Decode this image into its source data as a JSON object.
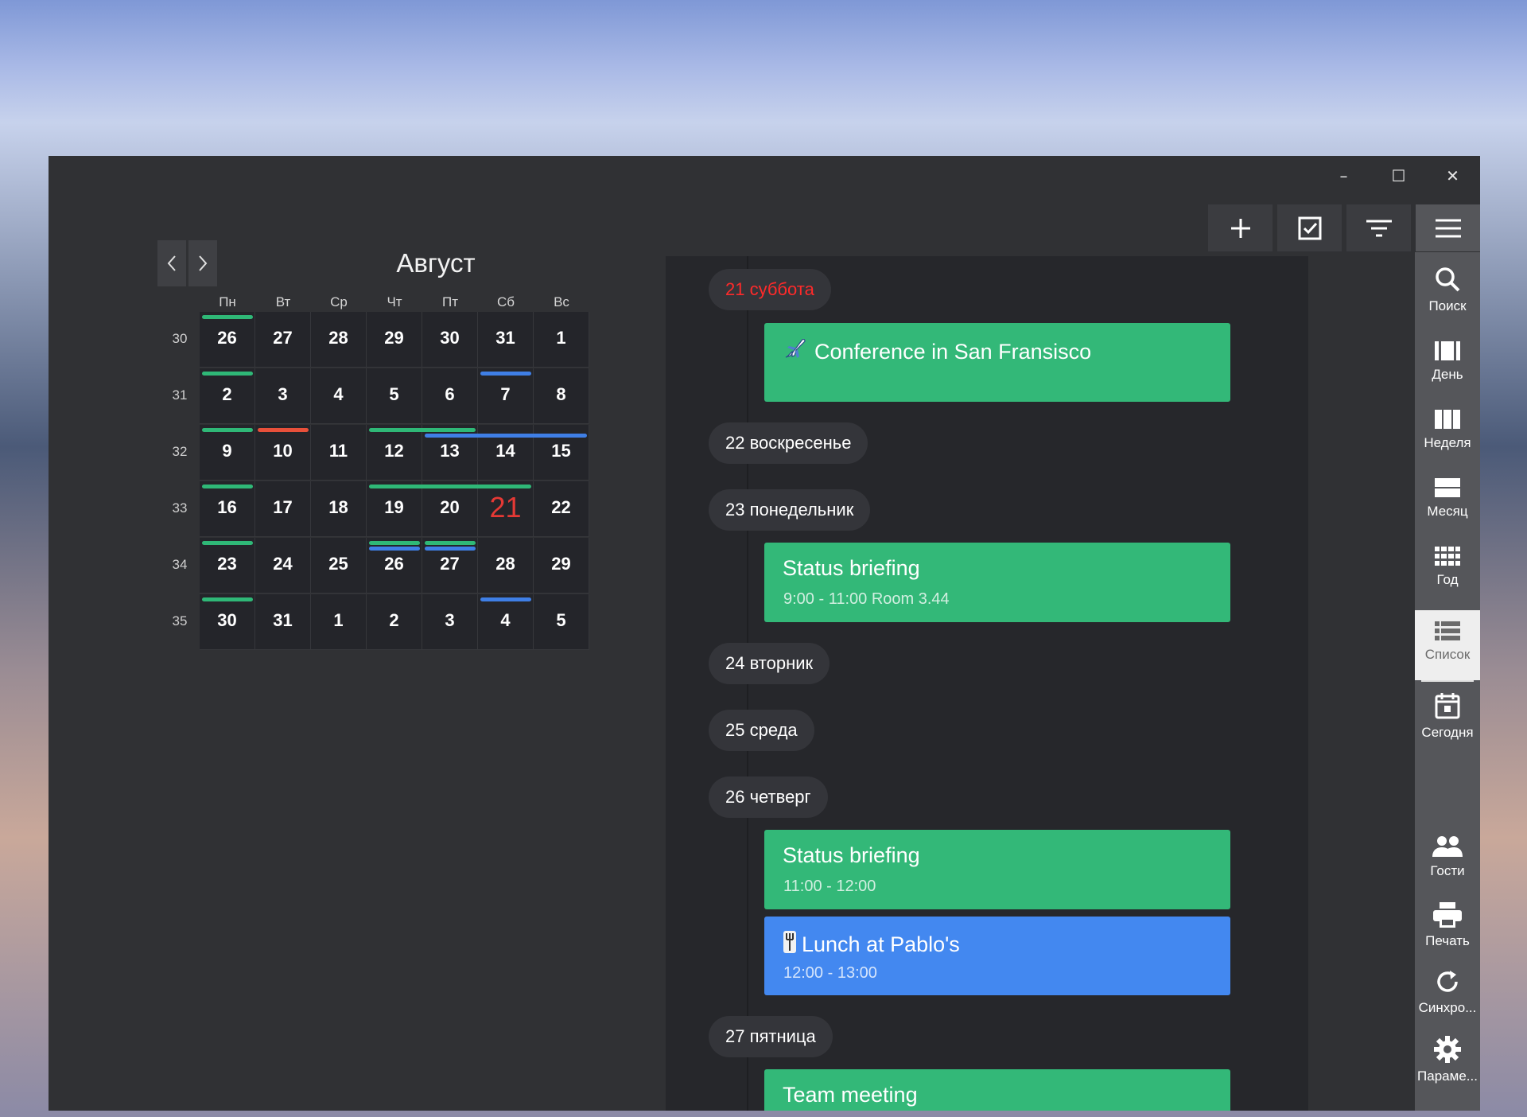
{
  "window": {
    "controls": {
      "minimize": "–",
      "maximize": "☐",
      "close": "✕"
    }
  },
  "toolbar": {
    "buttons": [
      {
        "name": "add-button",
        "icon": "plus-icon"
      },
      {
        "name": "tasks-button",
        "icon": "checkbox-icon"
      },
      {
        "name": "filter-button",
        "icon": "filter-icon"
      },
      {
        "name": "menu-button",
        "icon": "hamburger-icon"
      }
    ]
  },
  "rail": {
    "items": [
      {
        "id": "search",
        "icon": "search-icon",
        "label": "Поиск"
      },
      {
        "id": "day",
        "icon": "day-view-icon",
        "label": "День"
      },
      {
        "id": "week",
        "icon": "week-view-icon",
        "label": "Неделя"
      },
      {
        "id": "month",
        "icon": "month-view-icon",
        "label": "Месяц"
      },
      {
        "id": "year",
        "icon": "year-view-icon",
        "label": "Год"
      },
      {
        "id": "list",
        "icon": "list-view-icon",
        "label": "Список",
        "active": true
      },
      {
        "id": "today",
        "icon": "today-icon",
        "label": "Сегодня"
      },
      {
        "id": "guests",
        "icon": "people-icon",
        "label": "Гости"
      },
      {
        "id": "print",
        "icon": "printer-icon",
        "label": "Печать"
      },
      {
        "id": "sync",
        "icon": "sync-icon",
        "label": "Синхро..."
      },
      {
        "id": "settings",
        "icon": "gear-icon",
        "label": "Параме..."
      }
    ]
  },
  "calendar": {
    "month": "Август",
    "weekdays": [
      "Пн",
      "Вт",
      "Ср",
      "Чт",
      "Пт",
      "Сб",
      "Вс"
    ],
    "weeks": [
      {
        "number": "30",
        "days": [
          "26",
          "27",
          "28",
          "29",
          "30",
          "31",
          "1"
        ]
      },
      {
        "number": "31",
        "days": [
          "2",
          "3",
          "4",
          "5",
          "6",
          "7",
          "8"
        ]
      },
      {
        "number": "32",
        "days": [
          "9",
          "10",
          "11",
          "12",
          "13",
          "14",
          "15"
        ]
      },
      {
        "number": "33",
        "days": [
          "16",
          "17",
          "18",
          "19",
          "20",
          "21",
          "22"
        ]
      },
      {
        "number": "34",
        "days": [
          "23",
          "24",
          "25",
          "26",
          "27",
          "28",
          "29"
        ]
      },
      {
        "number": "35",
        "days": [
          "30",
          "31",
          "1",
          "2",
          "3",
          "4",
          "5"
        ]
      }
    ],
    "today": "21",
    "colors": {
      "green": "#2fb877",
      "blue": "#3f7fe6",
      "red": "#e8503a",
      "today": "#e53935"
    }
  },
  "agenda": {
    "days": [
      {
        "label": "21 суббота",
        "highlight": true
      },
      {
        "label": "22 воскресенье"
      },
      {
        "label": "23 понедельник"
      },
      {
        "label": "24 вторник"
      },
      {
        "label": "25 среда"
      },
      {
        "label": "26 четверг"
      },
      {
        "label": "27 пятница"
      }
    ],
    "events": [
      {
        "title": "Conference in San Fransisco",
        "subtitle": "",
        "icon": "airplane-icon",
        "color": "#33b878"
      },
      {
        "title": "Status briefing",
        "subtitle": "9:00 - 11:00 Room 3.44",
        "icon": "",
        "color": "#33b878"
      },
      {
        "title": "Status briefing",
        "subtitle": "11:00 - 12:00",
        "icon": "",
        "color": "#33b878"
      },
      {
        "title": "Lunch at Pablo's",
        "subtitle": "12:00 - 13:00",
        "icon": "cutlery-icon",
        "color": "#4388f0"
      },
      {
        "title": "Team meeting",
        "subtitle": "",
        "icon": "",
        "color": "#33b878"
      }
    ]
  }
}
